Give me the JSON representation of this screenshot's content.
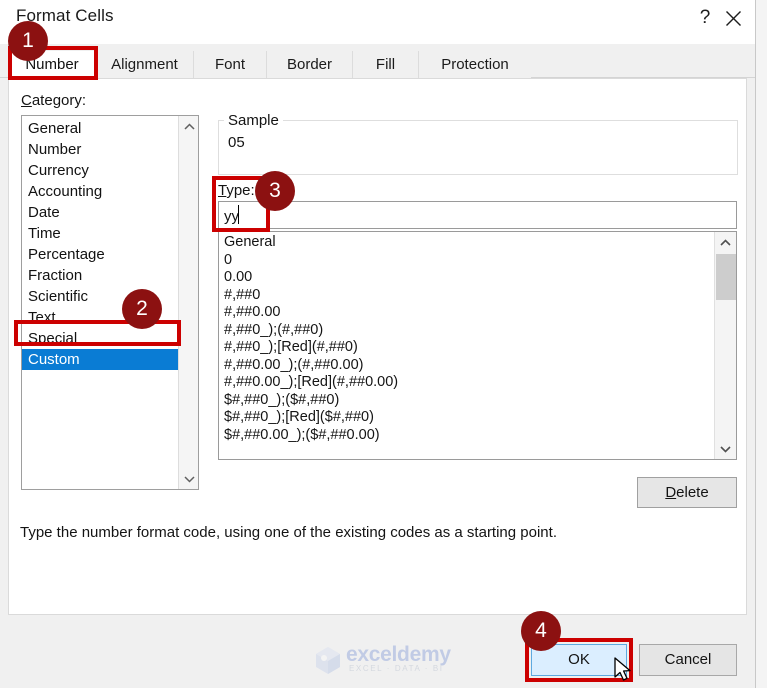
{
  "window": {
    "title": "Format Cells",
    "help_icon": "question-mark-icon",
    "close_icon": "close-icon"
  },
  "tabs": [
    {
      "label": "Number",
      "active": true
    },
    {
      "label": "Alignment",
      "active": false
    },
    {
      "label": "Font",
      "active": false
    },
    {
      "label": "Border",
      "active": false
    },
    {
      "label": "Fill",
      "active": false
    },
    {
      "label": "Protection",
      "active": false
    }
  ],
  "category": {
    "label": "Category:",
    "items": [
      "General",
      "Number",
      "Currency",
      "Accounting",
      "Date",
      "Time",
      "Percentage",
      "Fraction",
      "Scientific",
      "Text",
      "Special",
      "Custom"
    ],
    "selected": "Custom"
  },
  "sample": {
    "legend": "Sample",
    "value": "05"
  },
  "type": {
    "label": "Type:",
    "value": "yy"
  },
  "format_codes": [
    "General",
    "0",
    "0.00",
    "#,##0",
    "#,##0.00",
    "#,##0_);(#,##0)",
    "#,##0_);[Red](#,##0)",
    "#,##0.00_);(#,##0.00)",
    "#,##0.00_);[Red](#,##0.00)",
    "$#,##0_);($#,##0)",
    "$#,##0_);[Red]($#,##0)",
    "$#,##0.00_);($#,##0.00)"
  ],
  "buttons": {
    "delete": "Delete",
    "ok": "OK",
    "cancel": "Cancel"
  },
  "description": "Type the number format code, using one of the existing codes as a starting point.",
  "annotations": {
    "badges": [
      "1",
      "2",
      "3",
      "4"
    ],
    "box_color": "#cc0000",
    "badge_color": "#8c1111"
  },
  "watermark": {
    "brand": "exceldemy",
    "tagline": "EXCEL · DATA · BI"
  }
}
